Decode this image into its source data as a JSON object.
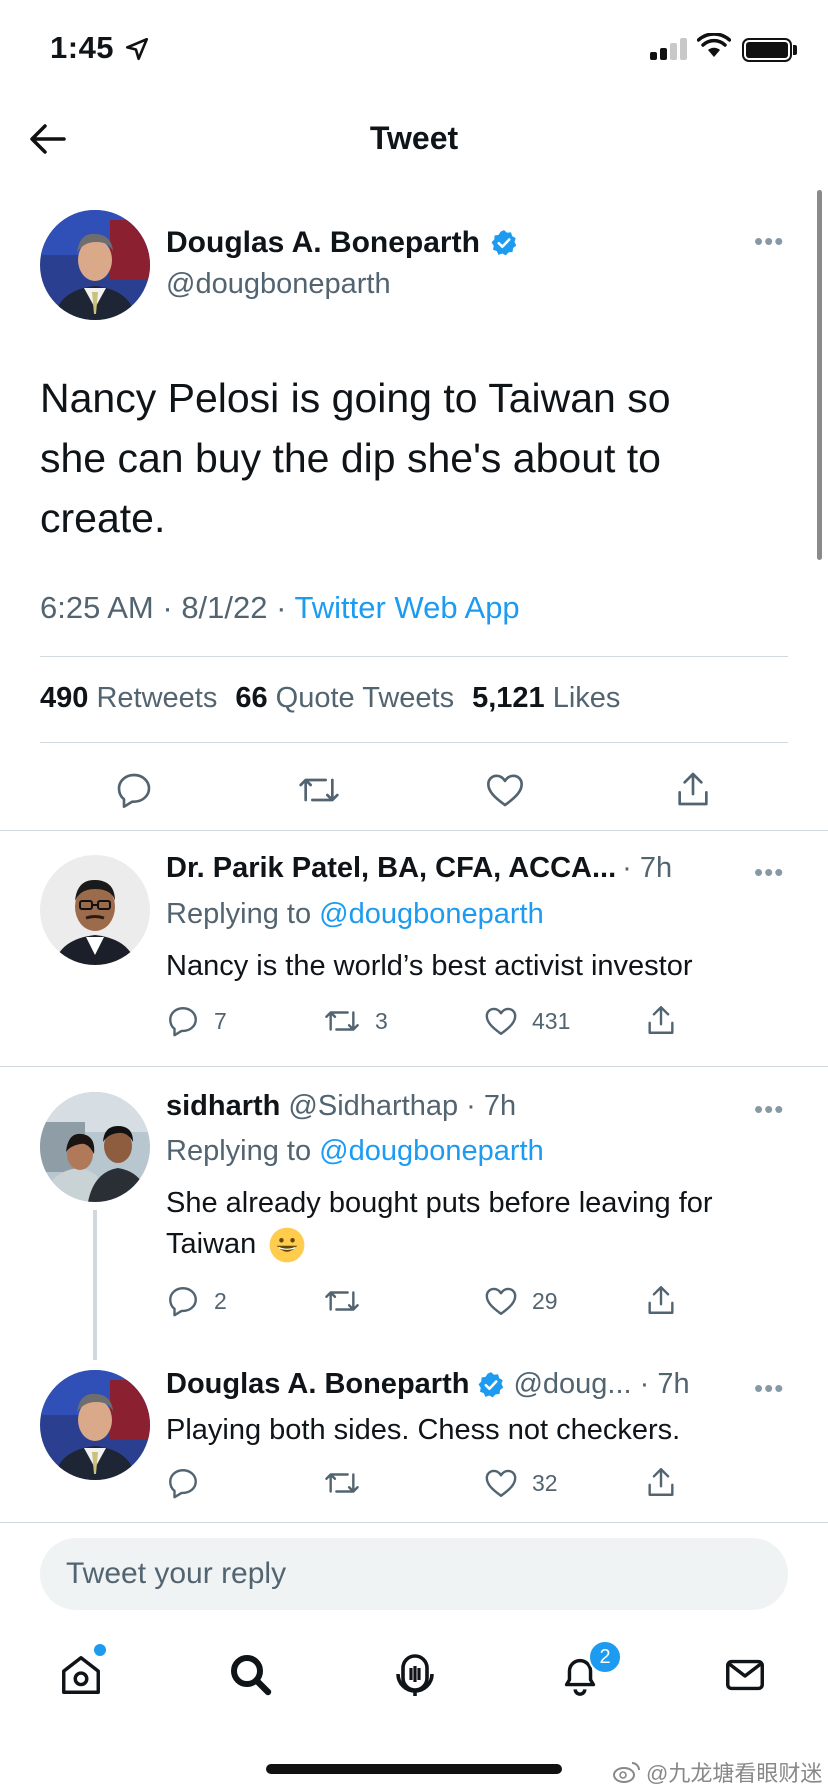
{
  "status_bar": {
    "time": "1:45"
  },
  "header": {
    "title": "Tweet"
  },
  "main_tweet": {
    "author_name": "Douglas A. Boneparth",
    "handle": "@dougboneparth",
    "text_lines": [
      "Nancy Pelosi is going to Taiwan so",
      "she can buy the dip she's about to",
      "create."
    ],
    "time": "6:25 AM",
    "date": "8/1/22",
    "source": "Twitter Web App",
    "retweets": "490",
    "retweets_label": "Retweets",
    "quotes": "66",
    "quotes_label": "Quote Tweets",
    "likes": "5,121",
    "likes_label": "Likes"
  },
  "replies": [
    {
      "name": "Dr. Parik Patel, BA, CFA, ACCA...",
      "meta": "· 7h",
      "replying_prefix": "Replying to",
      "replying_to": "@dougboneparth",
      "text": "Nancy is the world’s best activist investor",
      "replies": "7",
      "retweets": "3",
      "likes": "431"
    },
    {
      "name": "sidharth",
      "meta": "@Sidharthap · 7h",
      "replying_prefix": "Replying to",
      "replying_to": "@dougboneparth",
      "text_line1": "She already bought puts before leaving for",
      "text_line2": "Taiwan",
      "replies": "2",
      "retweets": "",
      "likes": "29"
    },
    {
      "name": "Douglas A. Boneparth",
      "meta": "@doug... · 7h",
      "text": "Playing both sides. Chess not checkers.",
      "replies": "",
      "retweets": "",
      "likes": "32"
    }
  ],
  "compose": {
    "placeholder": "Tweet your reply"
  },
  "tab_bar": {
    "items": [
      "home-icon",
      "search-icon",
      "spaces-icon",
      "notifications-icon",
      "messages-icon"
    ],
    "notification_count": "2"
  },
  "watermark": "@九龙塘看眼财迷",
  "colors": {
    "accent": "#1d9bf0",
    "text": "#0f1419",
    "secondary": "#536471"
  }
}
